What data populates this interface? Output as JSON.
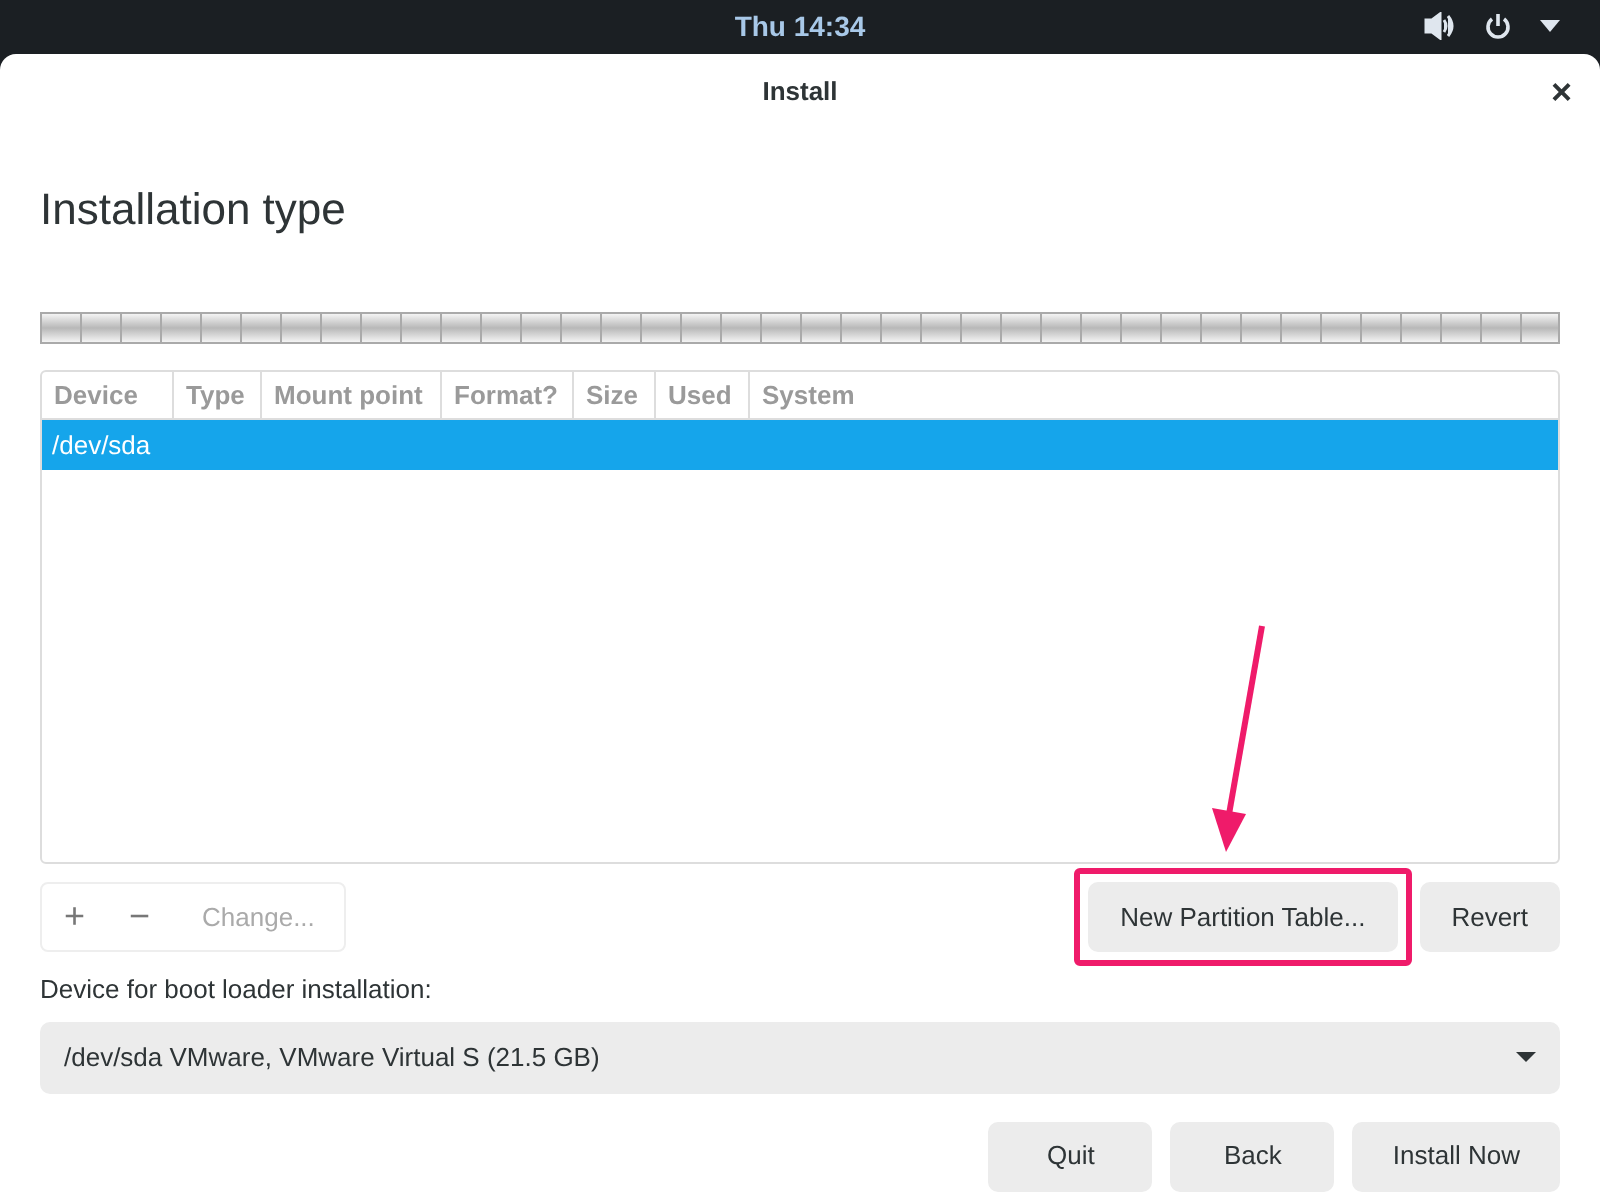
{
  "top_bar": {
    "clock": "Thu 14:34"
  },
  "window": {
    "title": "Install",
    "close": "×"
  },
  "heading": "Installation type",
  "table": {
    "columns": [
      "Device",
      "Type",
      "Mount point",
      "Format?",
      "Size",
      "Used",
      "System"
    ],
    "rows": [
      {
        "device": "/dev/sda",
        "selected": true
      }
    ]
  },
  "toolbar": [
    {
      "label": "+",
      "disabled": false
    },
    {
      "label": "−",
      "disabled": false
    },
    {
      "label": "Change...",
      "disabled": true
    }
  ],
  "actions": [
    {
      "label": "New Partition Table...",
      "highlighted": true
    },
    {
      "label": "Revert",
      "highlighted": false
    }
  ],
  "boot_loader": {
    "label": "Device for boot loader installation:",
    "value": "/dev/sda VMware, VMware Virtual S (21.5 GB)"
  },
  "buttons": [
    "Quit",
    "Back",
    "Install Now"
  ]
}
